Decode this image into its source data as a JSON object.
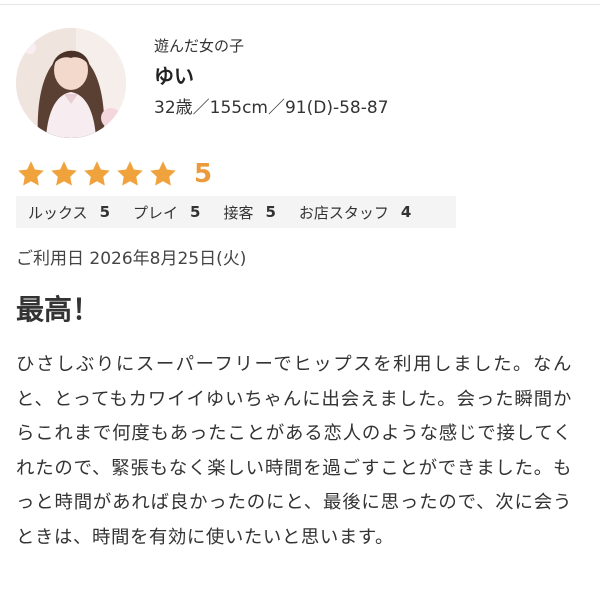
{
  "profile": {
    "caption": "遊んだ女の子",
    "name": "ゆい",
    "stats": "32歳／155cm／91(D)-58-87"
  },
  "rating": {
    "stars_filled": 5,
    "stars_total": 5,
    "value": "5",
    "star_color": "#f0a33d"
  },
  "subscores": [
    {
      "label": "ルックス",
      "value": "5"
    },
    {
      "label": "プレイ",
      "value": "5"
    },
    {
      "label": "接客",
      "value": "5"
    },
    {
      "label": "お店スタッフ",
      "value": "4"
    }
  ],
  "review": {
    "date": "ご利用日 2026年8月25日(火)",
    "title": "最高！",
    "body": "ひさしぶりにスーパーフリーでヒップスを利用しました。なんと、とってもカワイイゆいちゃんに出会えました。会った瞬間からこれまで何度もあったことがある恋人のような感じで接してくれたので、緊張もなく楽しい時間を過ごすことができました。もっと時間があれば良かったのにと、最後に思ったので、次に会うときは、時間を有効に使いたいと思います。"
  }
}
